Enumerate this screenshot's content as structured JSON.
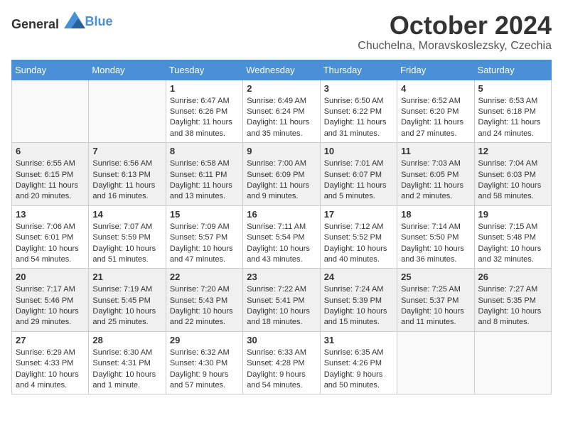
{
  "header": {
    "logo_general": "General",
    "logo_blue": "Blue",
    "month": "October 2024",
    "location": "Chuchelna, Moravskoslezsky, Czechia"
  },
  "days_of_week": [
    "Sunday",
    "Monday",
    "Tuesday",
    "Wednesday",
    "Thursday",
    "Friday",
    "Saturday"
  ],
  "weeks": [
    [
      {
        "day": "",
        "sunrise": "",
        "sunset": "",
        "daylight": ""
      },
      {
        "day": "",
        "sunrise": "",
        "sunset": "",
        "daylight": ""
      },
      {
        "day": "1",
        "sunrise": "Sunrise: 6:47 AM",
        "sunset": "Sunset: 6:26 PM",
        "daylight": "Daylight: 11 hours and 38 minutes."
      },
      {
        "day": "2",
        "sunrise": "Sunrise: 6:49 AM",
        "sunset": "Sunset: 6:24 PM",
        "daylight": "Daylight: 11 hours and 35 minutes."
      },
      {
        "day": "3",
        "sunrise": "Sunrise: 6:50 AM",
        "sunset": "Sunset: 6:22 PM",
        "daylight": "Daylight: 11 hours and 31 minutes."
      },
      {
        "day": "4",
        "sunrise": "Sunrise: 6:52 AM",
        "sunset": "Sunset: 6:20 PM",
        "daylight": "Daylight: 11 hours and 27 minutes."
      },
      {
        "day": "5",
        "sunrise": "Sunrise: 6:53 AM",
        "sunset": "Sunset: 6:18 PM",
        "daylight": "Daylight: 11 hours and 24 minutes."
      }
    ],
    [
      {
        "day": "6",
        "sunrise": "Sunrise: 6:55 AM",
        "sunset": "Sunset: 6:15 PM",
        "daylight": "Daylight: 11 hours and 20 minutes."
      },
      {
        "day": "7",
        "sunrise": "Sunrise: 6:56 AM",
        "sunset": "Sunset: 6:13 PM",
        "daylight": "Daylight: 11 hours and 16 minutes."
      },
      {
        "day": "8",
        "sunrise": "Sunrise: 6:58 AM",
        "sunset": "Sunset: 6:11 PM",
        "daylight": "Daylight: 11 hours and 13 minutes."
      },
      {
        "day": "9",
        "sunrise": "Sunrise: 7:00 AM",
        "sunset": "Sunset: 6:09 PM",
        "daylight": "Daylight: 11 hours and 9 minutes."
      },
      {
        "day": "10",
        "sunrise": "Sunrise: 7:01 AM",
        "sunset": "Sunset: 6:07 PM",
        "daylight": "Daylight: 11 hours and 5 minutes."
      },
      {
        "day": "11",
        "sunrise": "Sunrise: 7:03 AM",
        "sunset": "Sunset: 6:05 PM",
        "daylight": "Daylight: 11 hours and 2 minutes."
      },
      {
        "day": "12",
        "sunrise": "Sunrise: 7:04 AM",
        "sunset": "Sunset: 6:03 PM",
        "daylight": "Daylight: 10 hours and 58 minutes."
      }
    ],
    [
      {
        "day": "13",
        "sunrise": "Sunrise: 7:06 AM",
        "sunset": "Sunset: 6:01 PM",
        "daylight": "Daylight: 10 hours and 54 minutes."
      },
      {
        "day": "14",
        "sunrise": "Sunrise: 7:07 AM",
        "sunset": "Sunset: 5:59 PM",
        "daylight": "Daylight: 10 hours and 51 minutes."
      },
      {
        "day": "15",
        "sunrise": "Sunrise: 7:09 AM",
        "sunset": "Sunset: 5:57 PM",
        "daylight": "Daylight: 10 hours and 47 minutes."
      },
      {
        "day": "16",
        "sunrise": "Sunrise: 7:11 AM",
        "sunset": "Sunset: 5:54 PM",
        "daylight": "Daylight: 10 hours and 43 minutes."
      },
      {
        "day": "17",
        "sunrise": "Sunrise: 7:12 AM",
        "sunset": "Sunset: 5:52 PM",
        "daylight": "Daylight: 10 hours and 40 minutes."
      },
      {
        "day": "18",
        "sunrise": "Sunrise: 7:14 AM",
        "sunset": "Sunset: 5:50 PM",
        "daylight": "Daylight: 10 hours and 36 minutes."
      },
      {
        "day": "19",
        "sunrise": "Sunrise: 7:15 AM",
        "sunset": "Sunset: 5:48 PM",
        "daylight": "Daylight: 10 hours and 32 minutes."
      }
    ],
    [
      {
        "day": "20",
        "sunrise": "Sunrise: 7:17 AM",
        "sunset": "Sunset: 5:46 PM",
        "daylight": "Daylight: 10 hours and 29 minutes."
      },
      {
        "day": "21",
        "sunrise": "Sunrise: 7:19 AM",
        "sunset": "Sunset: 5:45 PM",
        "daylight": "Daylight: 10 hours and 25 minutes."
      },
      {
        "day": "22",
        "sunrise": "Sunrise: 7:20 AM",
        "sunset": "Sunset: 5:43 PM",
        "daylight": "Daylight: 10 hours and 22 minutes."
      },
      {
        "day": "23",
        "sunrise": "Sunrise: 7:22 AM",
        "sunset": "Sunset: 5:41 PM",
        "daylight": "Daylight: 10 hours and 18 minutes."
      },
      {
        "day": "24",
        "sunrise": "Sunrise: 7:24 AM",
        "sunset": "Sunset: 5:39 PM",
        "daylight": "Daylight: 10 hours and 15 minutes."
      },
      {
        "day": "25",
        "sunrise": "Sunrise: 7:25 AM",
        "sunset": "Sunset: 5:37 PM",
        "daylight": "Daylight: 10 hours and 11 minutes."
      },
      {
        "day": "26",
        "sunrise": "Sunrise: 7:27 AM",
        "sunset": "Sunset: 5:35 PM",
        "daylight": "Daylight: 10 hours and 8 minutes."
      }
    ],
    [
      {
        "day": "27",
        "sunrise": "Sunrise: 6:29 AM",
        "sunset": "Sunset: 4:33 PM",
        "daylight": "Daylight: 10 hours and 4 minutes."
      },
      {
        "day": "28",
        "sunrise": "Sunrise: 6:30 AM",
        "sunset": "Sunset: 4:31 PM",
        "daylight": "Daylight: 10 hours and 1 minute."
      },
      {
        "day": "29",
        "sunrise": "Sunrise: 6:32 AM",
        "sunset": "Sunset: 4:30 PM",
        "daylight": "Daylight: 9 hours and 57 minutes."
      },
      {
        "day": "30",
        "sunrise": "Sunrise: 6:33 AM",
        "sunset": "Sunset: 4:28 PM",
        "daylight": "Daylight: 9 hours and 54 minutes."
      },
      {
        "day": "31",
        "sunrise": "Sunrise: 6:35 AM",
        "sunset": "Sunset: 4:26 PM",
        "daylight": "Daylight: 9 hours and 50 minutes."
      },
      {
        "day": "",
        "sunrise": "",
        "sunset": "",
        "daylight": ""
      },
      {
        "day": "",
        "sunrise": "",
        "sunset": "",
        "daylight": ""
      }
    ]
  ]
}
